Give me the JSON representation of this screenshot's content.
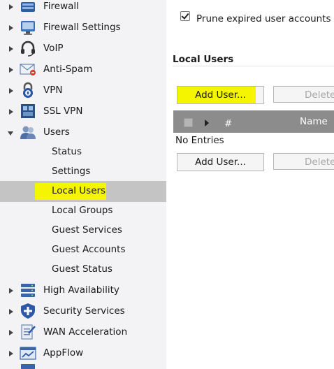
{
  "sidebar": {
    "items": [
      {
        "label": "Firewall",
        "icon": "firewall-icon",
        "expanded": false
      },
      {
        "label": "Firewall Settings",
        "icon": "firewall-settings-icon",
        "expanded": false
      },
      {
        "label": "VoIP",
        "icon": "headset-icon",
        "expanded": false
      },
      {
        "label": "Anti-Spam",
        "icon": "envelope-icon",
        "expanded": false
      },
      {
        "label": "VPN",
        "icon": "lock-icon",
        "expanded": false
      },
      {
        "label": "SSL VPN",
        "icon": "ssl-vpn-icon",
        "expanded": false
      },
      {
        "label": "Users",
        "icon": "users-icon",
        "expanded": true
      },
      {
        "label": "High Availability",
        "icon": "server-stack-icon",
        "expanded": false
      },
      {
        "label": "Security Services",
        "icon": "shield-icon",
        "expanded": false
      },
      {
        "label": "WAN Acceleration",
        "icon": "wan-acceleration-icon",
        "expanded": false
      },
      {
        "label": "AppFlow",
        "icon": "appflow-icon",
        "expanded": false
      }
    ],
    "users_children": [
      {
        "label": "Status"
      },
      {
        "label": "Settings"
      },
      {
        "label": "Local Users",
        "selected": true
      },
      {
        "label": "Local Groups"
      },
      {
        "label": "Guest Services"
      },
      {
        "label": "Guest Accounts"
      },
      {
        "label": "Guest Status"
      }
    ]
  },
  "main": {
    "prune_checkbox": {
      "label": "Prune expired user accounts",
      "checked": true
    },
    "section_title": "Local Users",
    "add_user_button": "Add User...",
    "delete_button": "Delete",
    "table": {
      "columns": [
        "#",
        "Name"
      ],
      "empty_text": "No Entries"
    }
  },
  "colors": {
    "highlight": "#f5f500",
    "selected_row": "#c4c4c4",
    "sidebar_bg": "#f3f3f6",
    "table_header_bg": "#8c8c8c"
  }
}
